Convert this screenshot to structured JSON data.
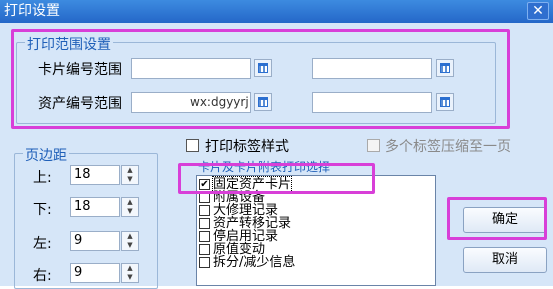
{
  "window": {
    "title": "打印设置",
    "close_glyph": "✕"
  },
  "print_range": {
    "legend": "打印范围设置",
    "card_no_label": "卡片编号范围",
    "asset_no_label": "资产编号范围",
    "card_from": "",
    "card_to": "",
    "asset_from": "",
    "asset_to": ""
  },
  "watermark": "wx:dgyyrj",
  "margins": {
    "legend": "页边距",
    "top_label": "上:",
    "top_value": "18",
    "bottom_label": "下:",
    "bottom_value": "18",
    "left_label": "左:",
    "left_value": "9",
    "right_label": "右:",
    "right_value": "9"
  },
  "options": {
    "print_label_style": "打印标签样式",
    "multi_label_compress": "多个标签压缩至一页",
    "attach_legend": "卡片及卡片附表打印选择"
  },
  "attach_list": [
    {
      "label": "固定资产卡片",
      "checked": true
    },
    {
      "label": "附属设备",
      "checked": false
    },
    {
      "label": "大修理记录",
      "checked": false
    },
    {
      "label": "资产转移记录",
      "checked": false
    },
    {
      "label": "停启用记录",
      "checked": false
    },
    {
      "label": "原值变动",
      "checked": false
    },
    {
      "label": "拆分/减少信息",
      "checked": false
    }
  ],
  "buttons": {
    "ok": "确定",
    "cancel": "取消"
  },
  "colors": {
    "title_bar": "#2467c8",
    "highlight": "#d83fd8",
    "legend_text": "#1f5fb8"
  }
}
